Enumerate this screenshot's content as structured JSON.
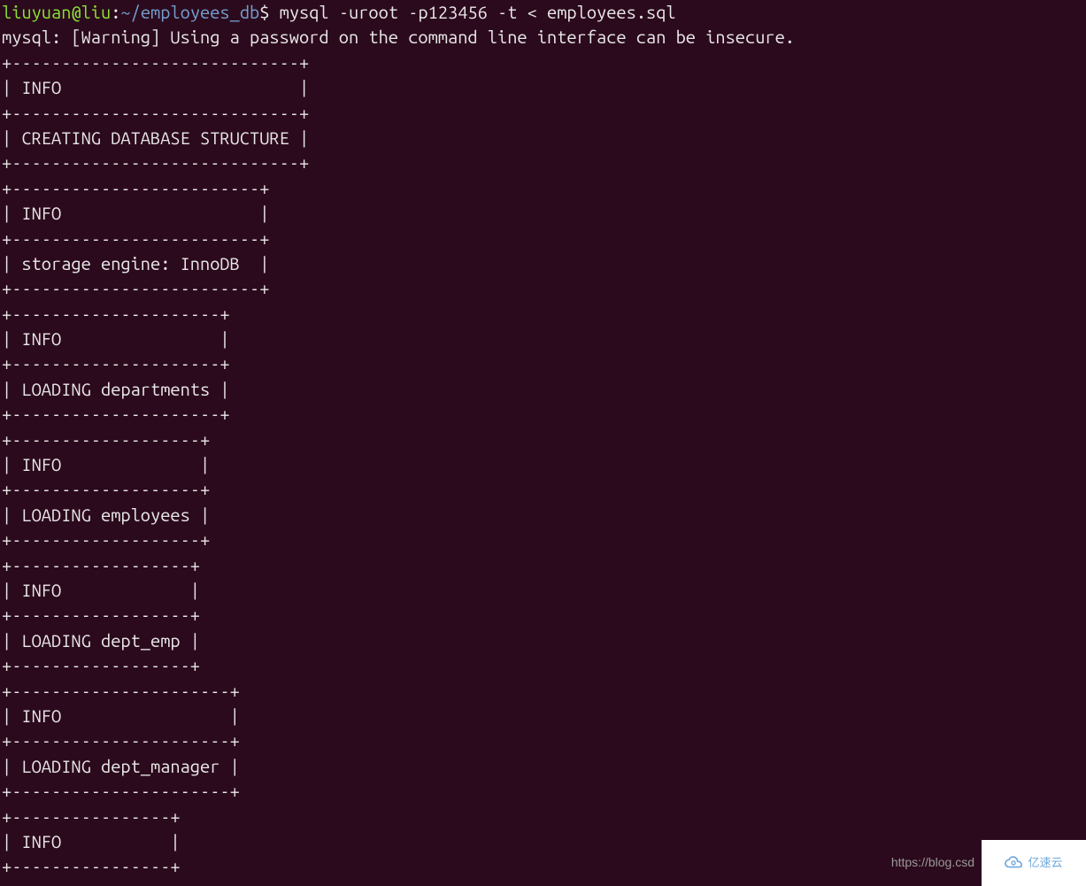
{
  "prompt": {
    "user": "liuyuan",
    "at": "@",
    "host": "liu",
    "colon": ":",
    "path": "~/employees_db",
    "dollar": "$",
    "command": " mysql -uroot -p123456 -t < employees.sql"
  },
  "warning": "mysql: [Warning] Using a password on the command line interface can be insecure.",
  "tables": [
    {
      "border": "+-----------------------------+",
      "header": "| INFO                        |",
      "row": "| CREATING DATABASE STRUCTURE |"
    },
    {
      "border": "+-------------------------+",
      "header": "| INFO                    |",
      "row": "| storage engine: InnoDB  |"
    },
    {
      "border": "+---------------------+",
      "header": "| INFO                |",
      "row": "| LOADING departments |"
    },
    {
      "border": "+-------------------+",
      "header": "| INFO              |",
      "row": "| LOADING employees |"
    },
    {
      "border": "+------------------+",
      "header": "| INFO             |",
      "row": "| LOADING dept_emp |"
    },
    {
      "border": "+----------------------+",
      "header": "| INFO                 |",
      "row": "| LOADING dept_manager |"
    },
    {
      "border": "+----------------+",
      "header": "| INFO           |",
      "row_partial_border": "+----------------+"
    }
  ],
  "watermark": {
    "text": "https://blog.csd",
    "logo_text": "亿速云"
  }
}
